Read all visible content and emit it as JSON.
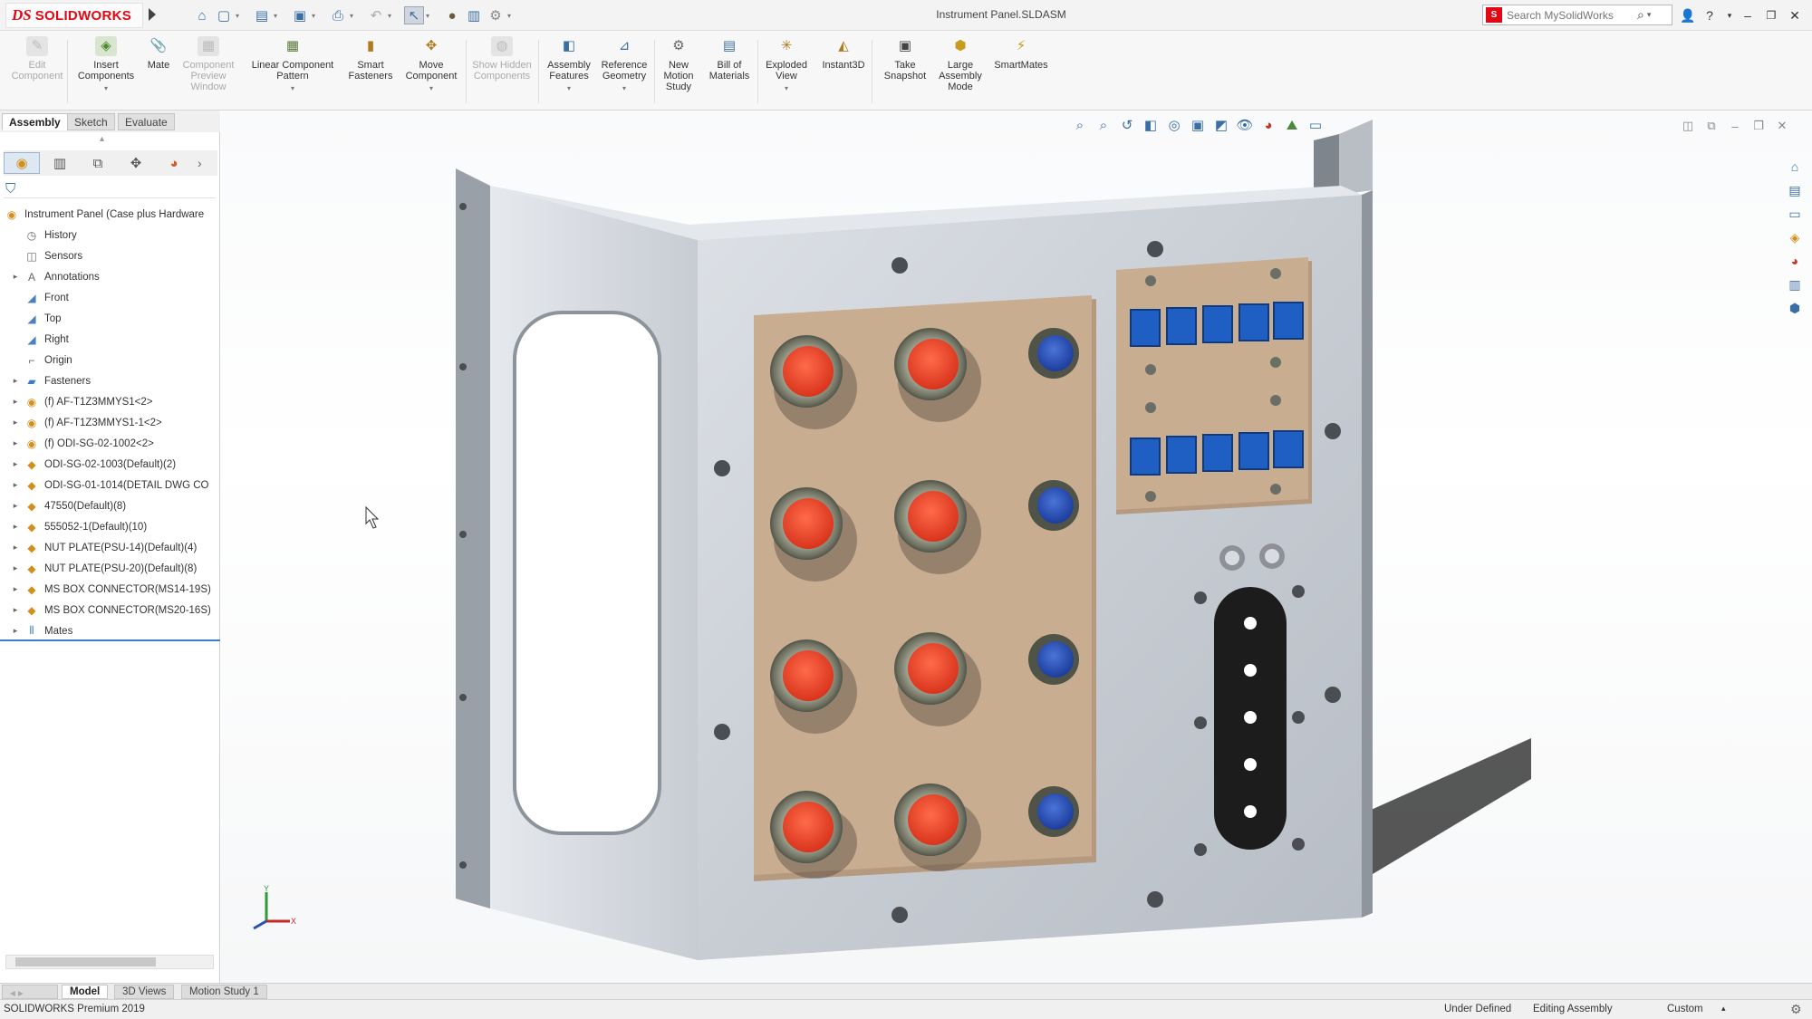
{
  "app": {
    "brand": "SOLIDWORKS",
    "doc_title": "Instrument Panel.SLDASM",
    "search_placeholder": "Search MySolidWorks"
  },
  "ribbon": [
    {
      "label": "Edit Component",
      "icon": "edit-component-icon",
      "disabled": true
    },
    {
      "label": "Insert Components",
      "icon": "insert-components-icon",
      "disabled": false
    },
    {
      "label": "Mate",
      "icon": "mate-icon",
      "disabled": false
    },
    {
      "label": "Component Preview Window",
      "icon": "component-preview-icon",
      "disabled": true
    },
    {
      "label": "Linear Component Pattern",
      "icon": "linear-pattern-icon",
      "disabled": false
    },
    {
      "label": "Smart Fasteners",
      "icon": "smart-fasteners-icon",
      "disabled": false
    },
    {
      "label": "Move Component",
      "icon": "move-component-icon",
      "disabled": false
    },
    {
      "label": "Show Hidden Components",
      "icon": "show-hidden-icon",
      "disabled": true
    },
    {
      "label": "Assembly Features",
      "icon": "assembly-features-icon",
      "disabled": false
    },
    {
      "label": "Reference Geometry",
      "icon": "reference-geometry-icon",
      "disabled": false
    },
    {
      "label": "New Motion Study",
      "icon": "motion-study-icon",
      "disabled": false
    },
    {
      "label": "Bill of Materials",
      "icon": "bom-icon",
      "disabled": false
    },
    {
      "label": "Exploded View",
      "icon": "exploded-view-icon",
      "disabled": false
    },
    {
      "label": "Instant3D",
      "icon": "instant3d-icon",
      "disabled": false
    },
    {
      "label": "Take Snapshot",
      "icon": "snapshot-icon",
      "disabled": false
    },
    {
      "label": "Large Assembly Mode",
      "icon": "large-assembly-icon",
      "disabled": false
    },
    {
      "label": "SmartMates",
      "icon": "smartmates-icon",
      "disabled": false
    }
  ],
  "cm_tabs": [
    "Assembly",
    "Sketch",
    "Evaluate"
  ],
  "tree": [
    {
      "label": "Instrument Panel (Case plus Hardware",
      "icon": "assembly-icon",
      "level": 0,
      "expand": ""
    },
    {
      "label": "History",
      "icon": "history-icon",
      "level": 1,
      "expand": ""
    },
    {
      "label": "Sensors",
      "icon": "sensors-icon",
      "level": 1,
      "expand": ""
    },
    {
      "label": "Annotations",
      "icon": "annotations-icon",
      "level": 1,
      "expand": "▸"
    },
    {
      "label": "Front",
      "icon": "plane-icon",
      "level": 1,
      "expand": ""
    },
    {
      "label": "Top",
      "icon": "plane-icon",
      "level": 1,
      "expand": ""
    },
    {
      "label": "Right",
      "icon": "plane-icon",
      "level": 1,
      "expand": ""
    },
    {
      "label": "Origin",
      "icon": "origin-icon",
      "level": 1,
      "expand": ""
    },
    {
      "label": "Fasteners",
      "icon": "folder-icon",
      "level": 1,
      "expand": "▸"
    },
    {
      "label": "(f) AF-T1Z3MMYS1<2>",
      "icon": "subassembly-icon",
      "level": 1,
      "expand": "▸"
    },
    {
      "label": "(f) AF-T1Z3MMYS1-1<2>",
      "icon": "subassembly-icon",
      "level": 1,
      "expand": "▸"
    },
    {
      "label": "(f) ODI-SG-02-1002<2>",
      "icon": "subassembly-icon",
      "level": 1,
      "expand": "▸"
    },
    {
      "label": "ODI-SG-02-1003(Default)(2)",
      "icon": "part-icon",
      "level": 1,
      "expand": "▸"
    },
    {
      "label": "ODI-SG-01-1014(DETAIL DWG CO",
      "icon": "part-icon",
      "level": 1,
      "expand": "▸"
    },
    {
      "label": "47550(Default)(8)",
      "icon": "part-icon",
      "level": 1,
      "expand": "▸"
    },
    {
      "label": "555052-1(Default)(10)",
      "icon": "part-icon",
      "level": 1,
      "expand": "▸"
    },
    {
      "label": "NUT PLATE(PSU-14)(Default)(4)",
      "icon": "part-icon",
      "level": 1,
      "expand": "▸"
    },
    {
      "label": "NUT PLATE(PSU-20)(Default)(8)",
      "icon": "part-icon",
      "level": 1,
      "expand": "▸"
    },
    {
      "label": "MS BOX CONNECTOR(MS14-19S)",
      "icon": "part-icon",
      "level": 1,
      "expand": "▸"
    },
    {
      "label": "MS BOX CONNECTOR(MS20-16S)",
      "icon": "part-icon",
      "level": 1,
      "expand": "▸"
    },
    {
      "label": "Mates",
      "icon": "mates-icon",
      "level": 1,
      "expand": "▸"
    }
  ],
  "model_tabs": [
    "Model",
    "3D Views",
    "Motion Study 1"
  ],
  "status": {
    "left": "SOLIDWORKS Premium 2019",
    "defined": "Under Defined",
    "mode": "Editing Assembly",
    "units": "Custom"
  },
  "colors": {
    "accent": "#3b7ec8",
    "brand": "#e30613",
    "tan_plate": "#c9ad91",
    "connector_red": "#e8452f",
    "connector_blue": "#2a4fb8",
    "rj45_blue": "#1f5fc4"
  }
}
